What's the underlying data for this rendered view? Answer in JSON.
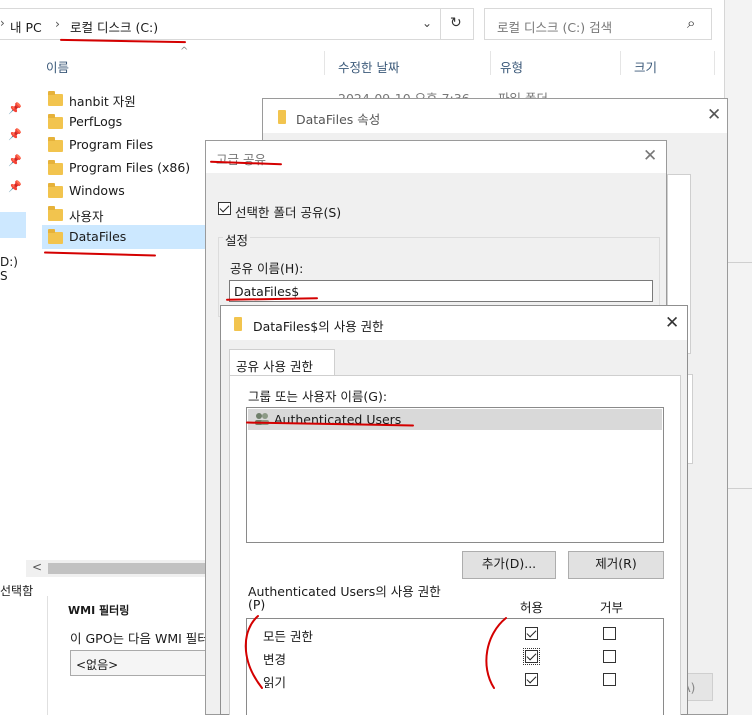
{
  "explorer": {
    "breadcrumb": {
      "pc": "내 PC",
      "sep": "›",
      "drive": "로컬 디스크 (C:)"
    },
    "search_placeholder": "로컬 디스크 (C:) 검색",
    "columns": {
      "name": "이름",
      "modified": "수정한 날짜",
      "type": "유형",
      "size": "크기"
    },
    "first_row_date": "2024-09-10 오후 7:36",
    "first_row_type": "파일 폴더",
    "files": [
      "hanbit 자원",
      "PerfLogs",
      "Program Files",
      "Program Files (x86)",
      "Windows",
      "사용자",
      "DataFiles"
    ],
    "left_drive_fragment": "D:) S",
    "status_selected": "선택함",
    "scroll_left": "<"
  },
  "gpo": {
    "heading": "WMI 필터링",
    "text": "이 GPO는 다음 WMI 필터",
    "select_value": "<없음>"
  },
  "properties": {
    "title": "DataFiles 속성",
    "bottom_fragment": "A)"
  },
  "advanced": {
    "title": "고급 공유",
    "share_checkbox_label": "선택한 폴더 공유(S)",
    "settings_group": "설정",
    "share_name_label": "공유 이름(H):",
    "share_name_value": "DataFiles$"
  },
  "permissions": {
    "title": "DataFiles$의 사용 권한",
    "tab": "공유 사용 권한",
    "group_label": "그룹 또는 사용자 이름(G):",
    "users": [
      "Authenticated Users"
    ],
    "add_button": "추가(D)...",
    "remove_button": "제거(R)",
    "perm_label_line1": "Authenticated Users의 사용 권한",
    "perm_label_line2": "(P)",
    "allow_header": "허용",
    "deny_header": "거부",
    "rows": [
      {
        "name": "모든 권한",
        "allow": true,
        "deny": false
      },
      {
        "name": "변경",
        "allow": true,
        "deny": false
      },
      {
        "name": "읽기",
        "allow": true,
        "deny": false
      }
    ]
  }
}
